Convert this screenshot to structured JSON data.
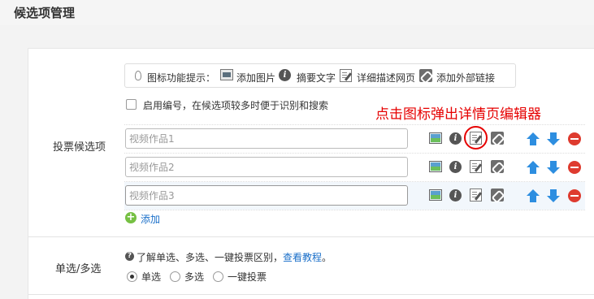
{
  "header": {
    "title": "候选项管理"
  },
  "hint": {
    "prefix": "图标功能提示：",
    "items": [
      "添加图片",
      "摘要文字",
      "详细描述网页",
      "添加外部链接"
    ]
  },
  "numbering": {
    "label": "启用编号，在候选项较多时便于识别和搜索",
    "checked": false
  },
  "annotation": "点击图标弹出详情页编辑器",
  "candidates": {
    "label": "投票候选项",
    "items": [
      {
        "placeholder": "视频作品1"
      },
      {
        "placeholder": "视频作品2"
      },
      {
        "placeholder": "视频作品3"
      }
    ],
    "add_label": "添加"
  },
  "mode": {
    "label": "单选/多选",
    "hint_text": "了解单选、多选、一键投票区别，",
    "tutorial_link": "查看教程",
    "hint_end": "。",
    "options": [
      {
        "label": "单选",
        "selected": true
      },
      {
        "label": "多选",
        "selected": false
      },
      {
        "label": "一键投票",
        "selected": false
      }
    ]
  },
  "colors": {
    "annotation": "#e60000",
    "link": "#1a6fc9",
    "arrow": "#2d8ee0",
    "delete": "#de3b2f",
    "add": "#76c043"
  }
}
